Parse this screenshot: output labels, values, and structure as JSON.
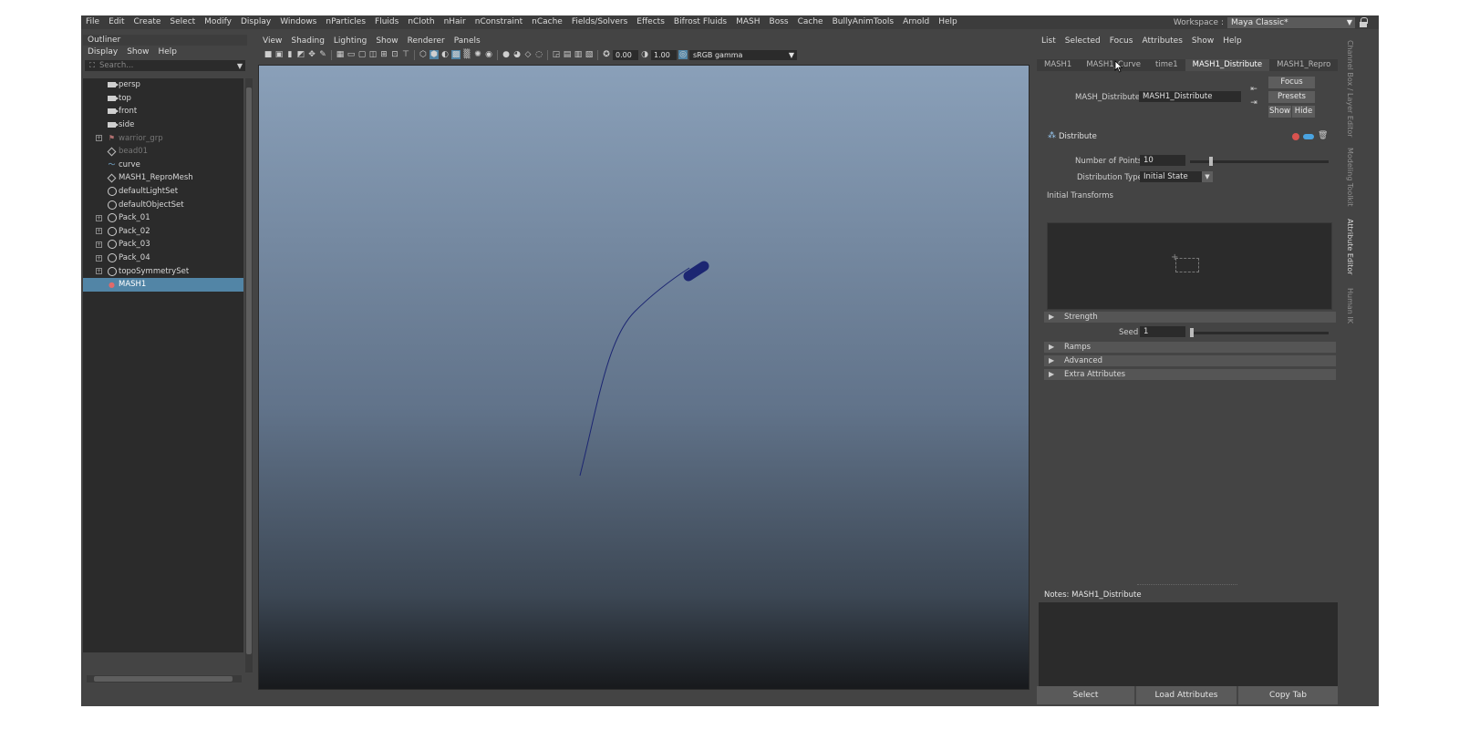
{
  "menubar": {
    "items": [
      "File",
      "Edit",
      "Create",
      "Select",
      "Modify",
      "Display",
      "Windows",
      "nParticles",
      "Fluids",
      "nCloth",
      "nHair",
      "nConstraint",
      "nCache",
      "Fields/Solvers",
      "Effects",
      "Bifrost Fluids",
      "MASH",
      "Boss",
      "Cache",
      "BullyAnimTools",
      "Arnold",
      "Help"
    ],
    "workspace_label": "Workspace :",
    "workspace_value": "Maya Classic*"
  },
  "outliner": {
    "title": "Outliner",
    "menu": [
      "Display",
      "Show",
      "Help"
    ],
    "search_placeholder": "Search...",
    "items": [
      {
        "label": "persp",
        "icon": "camera-icon",
        "expand": false,
        "state": "normal"
      },
      {
        "label": "top",
        "icon": "camera-icon",
        "expand": false,
        "state": "normal"
      },
      {
        "label": "front",
        "icon": "camera-icon",
        "expand": false,
        "state": "normal"
      },
      {
        "label": "side",
        "icon": "camera-icon",
        "expand": false,
        "state": "normal"
      },
      {
        "label": "warrior_grp",
        "icon": "group-icon",
        "expand": true,
        "state": "dim"
      },
      {
        "label": "bead01",
        "icon": "mesh-icon",
        "expand": false,
        "state": "dim"
      },
      {
        "label": "curve",
        "icon": "curve-icon",
        "expand": false,
        "state": "normal"
      },
      {
        "label": "MASH1_ReproMesh",
        "icon": "mesh-icon",
        "expand": false,
        "state": "normal"
      },
      {
        "label": "defaultLightSet",
        "icon": "set-icon",
        "expand": false,
        "state": "normal"
      },
      {
        "label": "defaultObjectSet",
        "icon": "set-icon",
        "expand": false,
        "state": "normal"
      },
      {
        "label": "Pack_01",
        "icon": "set-icon",
        "expand": true,
        "state": "normal"
      },
      {
        "label": "Pack_02",
        "icon": "set-icon",
        "expand": true,
        "state": "normal"
      },
      {
        "label": "Pack_03",
        "icon": "set-icon",
        "expand": true,
        "state": "normal"
      },
      {
        "label": "Pack_04",
        "icon": "set-icon",
        "expand": true,
        "state": "normal"
      },
      {
        "label": "topoSymmetrySet",
        "icon": "set-icon",
        "expand": true,
        "state": "normal"
      },
      {
        "label": "MASH1",
        "icon": "mash-icon",
        "expand": false,
        "state": "selected"
      }
    ]
  },
  "viewport": {
    "menu": [
      "View",
      "Shading",
      "Lighting",
      "Show",
      "Renderer",
      "Panels"
    ],
    "exposure": "0.00",
    "gamma": "1.00",
    "color_space": "sRGB gamma",
    "colors": {
      "selection": "#5285a6",
      "curve": "#1c2672"
    }
  },
  "attribute_editor": {
    "menu": [
      "List",
      "Selected",
      "Focus",
      "Attributes",
      "Show",
      "Help"
    ],
    "tabs": [
      "MASH1",
      "MASH1_Curve",
      "time1",
      "MASH1_Distribute",
      "MASH1_Repro"
    ],
    "active_tab": "MASH1_Distribute",
    "node_label": "MASH_Distribute:",
    "node_value": "MASH1_Distribute",
    "buttons": {
      "focus": "Focus",
      "presets": "Presets",
      "show": "Show",
      "hide": "Hide"
    },
    "node_header": "Distribute",
    "number_of_points_label": "Number of Points",
    "number_of_points_value": "10",
    "number_of_points_slider": 0.14,
    "distribution_type_label": "Distribution Type",
    "distribution_type_value": "Initial State",
    "initial_transforms_label": "Initial Transforms",
    "sections": {
      "strength": "Strength",
      "ramps": "Ramps",
      "advanced": "Advanced",
      "extra": "Extra Attributes"
    },
    "seed_label": "Seed",
    "seed_value": "1",
    "seed_slider": 0.0,
    "notes_label": "Notes:  MASH1_Distribute",
    "bottom_buttons": [
      "Select",
      "Load Attributes",
      "Copy Tab"
    ]
  },
  "side_tabs": [
    "Channel Box / Layer Editor",
    "Modeling Toolkit",
    "Attribute Editor",
    "Human IK"
  ]
}
